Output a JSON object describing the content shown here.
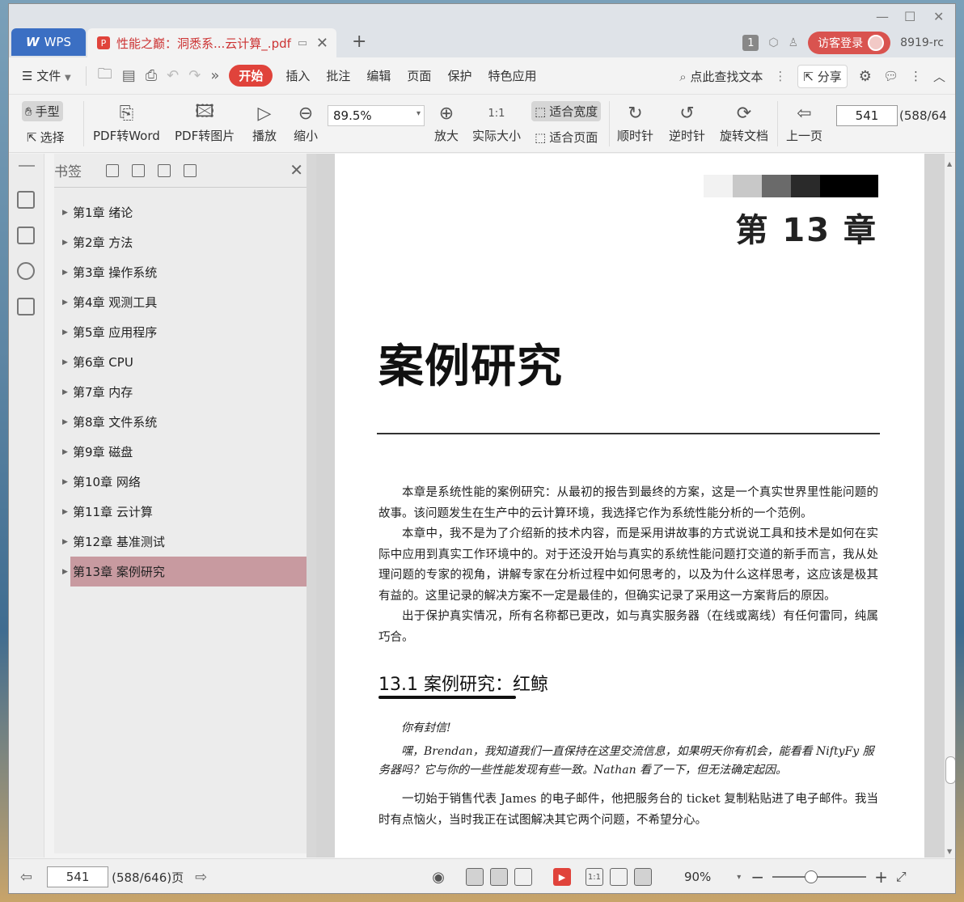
{
  "window": {
    "controls": {
      "minimize": "—",
      "maximize": "☐",
      "close": "✕"
    }
  },
  "tabs": {
    "app_tab": {
      "logo": "W",
      "label": "WPS"
    },
    "doc_tab": {
      "label": "性能之巅：洞悉系...云计算_.pdf",
      "close": "✕"
    },
    "add": "+"
  },
  "titlebar_right": {
    "badge": "1",
    "login_label": "访客登录",
    "username": "8919-rc"
  },
  "menubar": {
    "file_label": "文件",
    "tabs": [
      "开始",
      "插入",
      "批注",
      "编辑",
      "页面",
      "保护",
      "特色应用"
    ],
    "active_tab": "开始",
    "search_label": "点此查找文本",
    "share_label": "分享"
  },
  "ribbon": {
    "hand_label": "手型",
    "select_label": "选择",
    "pdf_to_word": "PDF转Word",
    "pdf_to_image": "PDF转图片",
    "play": "播放",
    "zoom_out": "缩小",
    "zoom_value": "89.5%",
    "zoom_in": "放大",
    "actual_size": "实际大小",
    "fit_width": "适合宽度",
    "fit_page": "适合页面",
    "rotate_cw": "顺时针",
    "rotate_ccw": "逆时针",
    "rotate_doc": "旋转文档",
    "prev_page": "上一页",
    "page_input": "541",
    "page_total": "(588/64"
  },
  "bookmarks": {
    "title": "书签",
    "items": [
      {
        "label": "第1章  绪论"
      },
      {
        "label": "第2章  方法"
      },
      {
        "label": "第3章  操作系统"
      },
      {
        "label": "第4章  观测工具"
      },
      {
        "label": "第5章  应用程序"
      },
      {
        "label": "第6章  CPU"
      },
      {
        "label": "第7章  内存"
      },
      {
        "label": "第8章  文件系统"
      },
      {
        "label": "第9章  磁盘"
      },
      {
        "label": "第10章  网络"
      },
      {
        "label": "第11章  云计算"
      },
      {
        "label": "第12章  基准测试"
      },
      {
        "label": "第13章  案例研究"
      }
    ],
    "selected_index": 12
  },
  "document": {
    "chapter_number": "第 13 章",
    "chapter_title": "案例研究",
    "paragraphs": [
      "本章是系统性能的案例研究：从最初的报告到最终的方案，这是一个真实世界里性能问题的故事。该问题发生在生产中的云计算环境，我选择它作为系统性能分析的一个范例。",
      "本章中，我不是为了介绍新的技术内容，而是采用讲故事的方式说说工具和技术是如何在实际中应用到真实工作环境中的。对于还没开始与真实的系统性能问题打交道的新手而言，我从处理问题的专家的视角，讲解专家在分析过程中如何思考的，以及为什么这样思考，这应该是极其有益的。这里记录的解决方案不一定是最佳的，但确实记录了采用这一方案背后的原因。",
      "出于保护真实情况，所有名称都已更改，如与真实服务器（在线或离线）有任何雷同，纯属巧合。"
    ],
    "section_title": "13.1   案例研究：红鲸",
    "email_lines": [
      "你有封信!",
      "嘿，Brendan，我知道我们一直保持在这里交流信息，如果明天你有机会，能看看 NiftyFy 服务器吗？它与你的一些性能发现有些一致。Nathan 看了一下，但无法确定起因。"
    ],
    "closing_paragraph": "一切始于销售代表 James 的电子邮件，他把服务台的 ticket 复制粘贴进了电子邮件。我当时有点恼火，当时我正在试图解决其它两个问题，不希望分心。"
  },
  "statusbar": {
    "page_input": "541",
    "page_total": "(588/646)页",
    "zoom_value": "90%",
    "zoom_level": 0.41
  },
  "colors": {
    "accent_red": "#e0433b",
    "wps_blue": "#3b6fc3",
    "bookmark_selected": "#c89aa0"
  }
}
